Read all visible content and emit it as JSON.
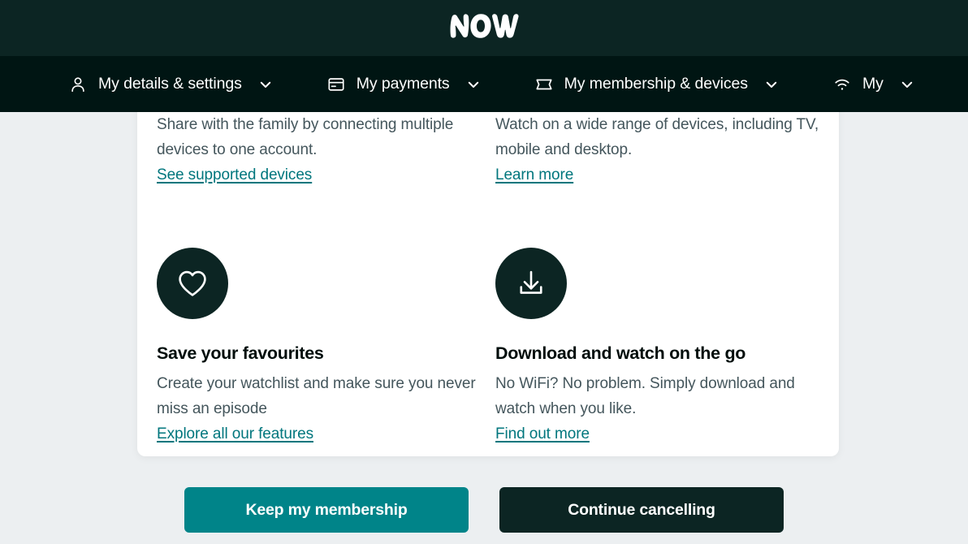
{
  "brand": {
    "logo_text": "NOW",
    "logo_icon": "now-logo"
  },
  "nav": {
    "items": [
      {
        "label": "My details & settings",
        "icon": "user-icon",
        "chevron": "chevron-down-icon"
      },
      {
        "label": "My payments",
        "icon": "credit-card-icon",
        "chevron": "chevron-down-icon"
      },
      {
        "label": "My membership & devices",
        "icon": "ticket-icon",
        "chevron": "chevron-down-icon"
      },
      {
        "label": "My",
        "icon": "wifi-icon",
        "chevron": "chevron-down-icon"
      }
    ]
  },
  "card": {
    "features": [
      {
        "icon": "devices-icon",
        "title": "",
        "body": "Share with the family by connecting multiple devices to one account.",
        "link": "See supported devices"
      },
      {
        "icon": "screen-icon",
        "title": "",
        "body": "Watch on a wide range of devices, including TV, mobile and desktop.",
        "link": "Learn more"
      },
      {
        "icon": "heart-icon",
        "title": "Save your favourites",
        "body": "Create your watchlist and make sure you never miss an episode",
        "link": "Explore all our features"
      },
      {
        "icon": "download-icon",
        "title": "Download and watch on the go",
        "body": "No WiFi? No problem. Simply download and watch when you like.",
        "link": "Find out more"
      }
    ]
  },
  "footer": {
    "keep_label": "Keep my membership",
    "cancel_label": "Continue cancelling"
  },
  "colors": {
    "page_background": "#eceff1",
    "brand_band": "#0c2523",
    "nav_band": "#001513",
    "card_background": "#ffffff",
    "link_teal": "#00767d",
    "keep_button": "#008489",
    "cancel_button": "#0c2523",
    "body_text": "#44565c",
    "heading_text": "#000d0b"
  }
}
